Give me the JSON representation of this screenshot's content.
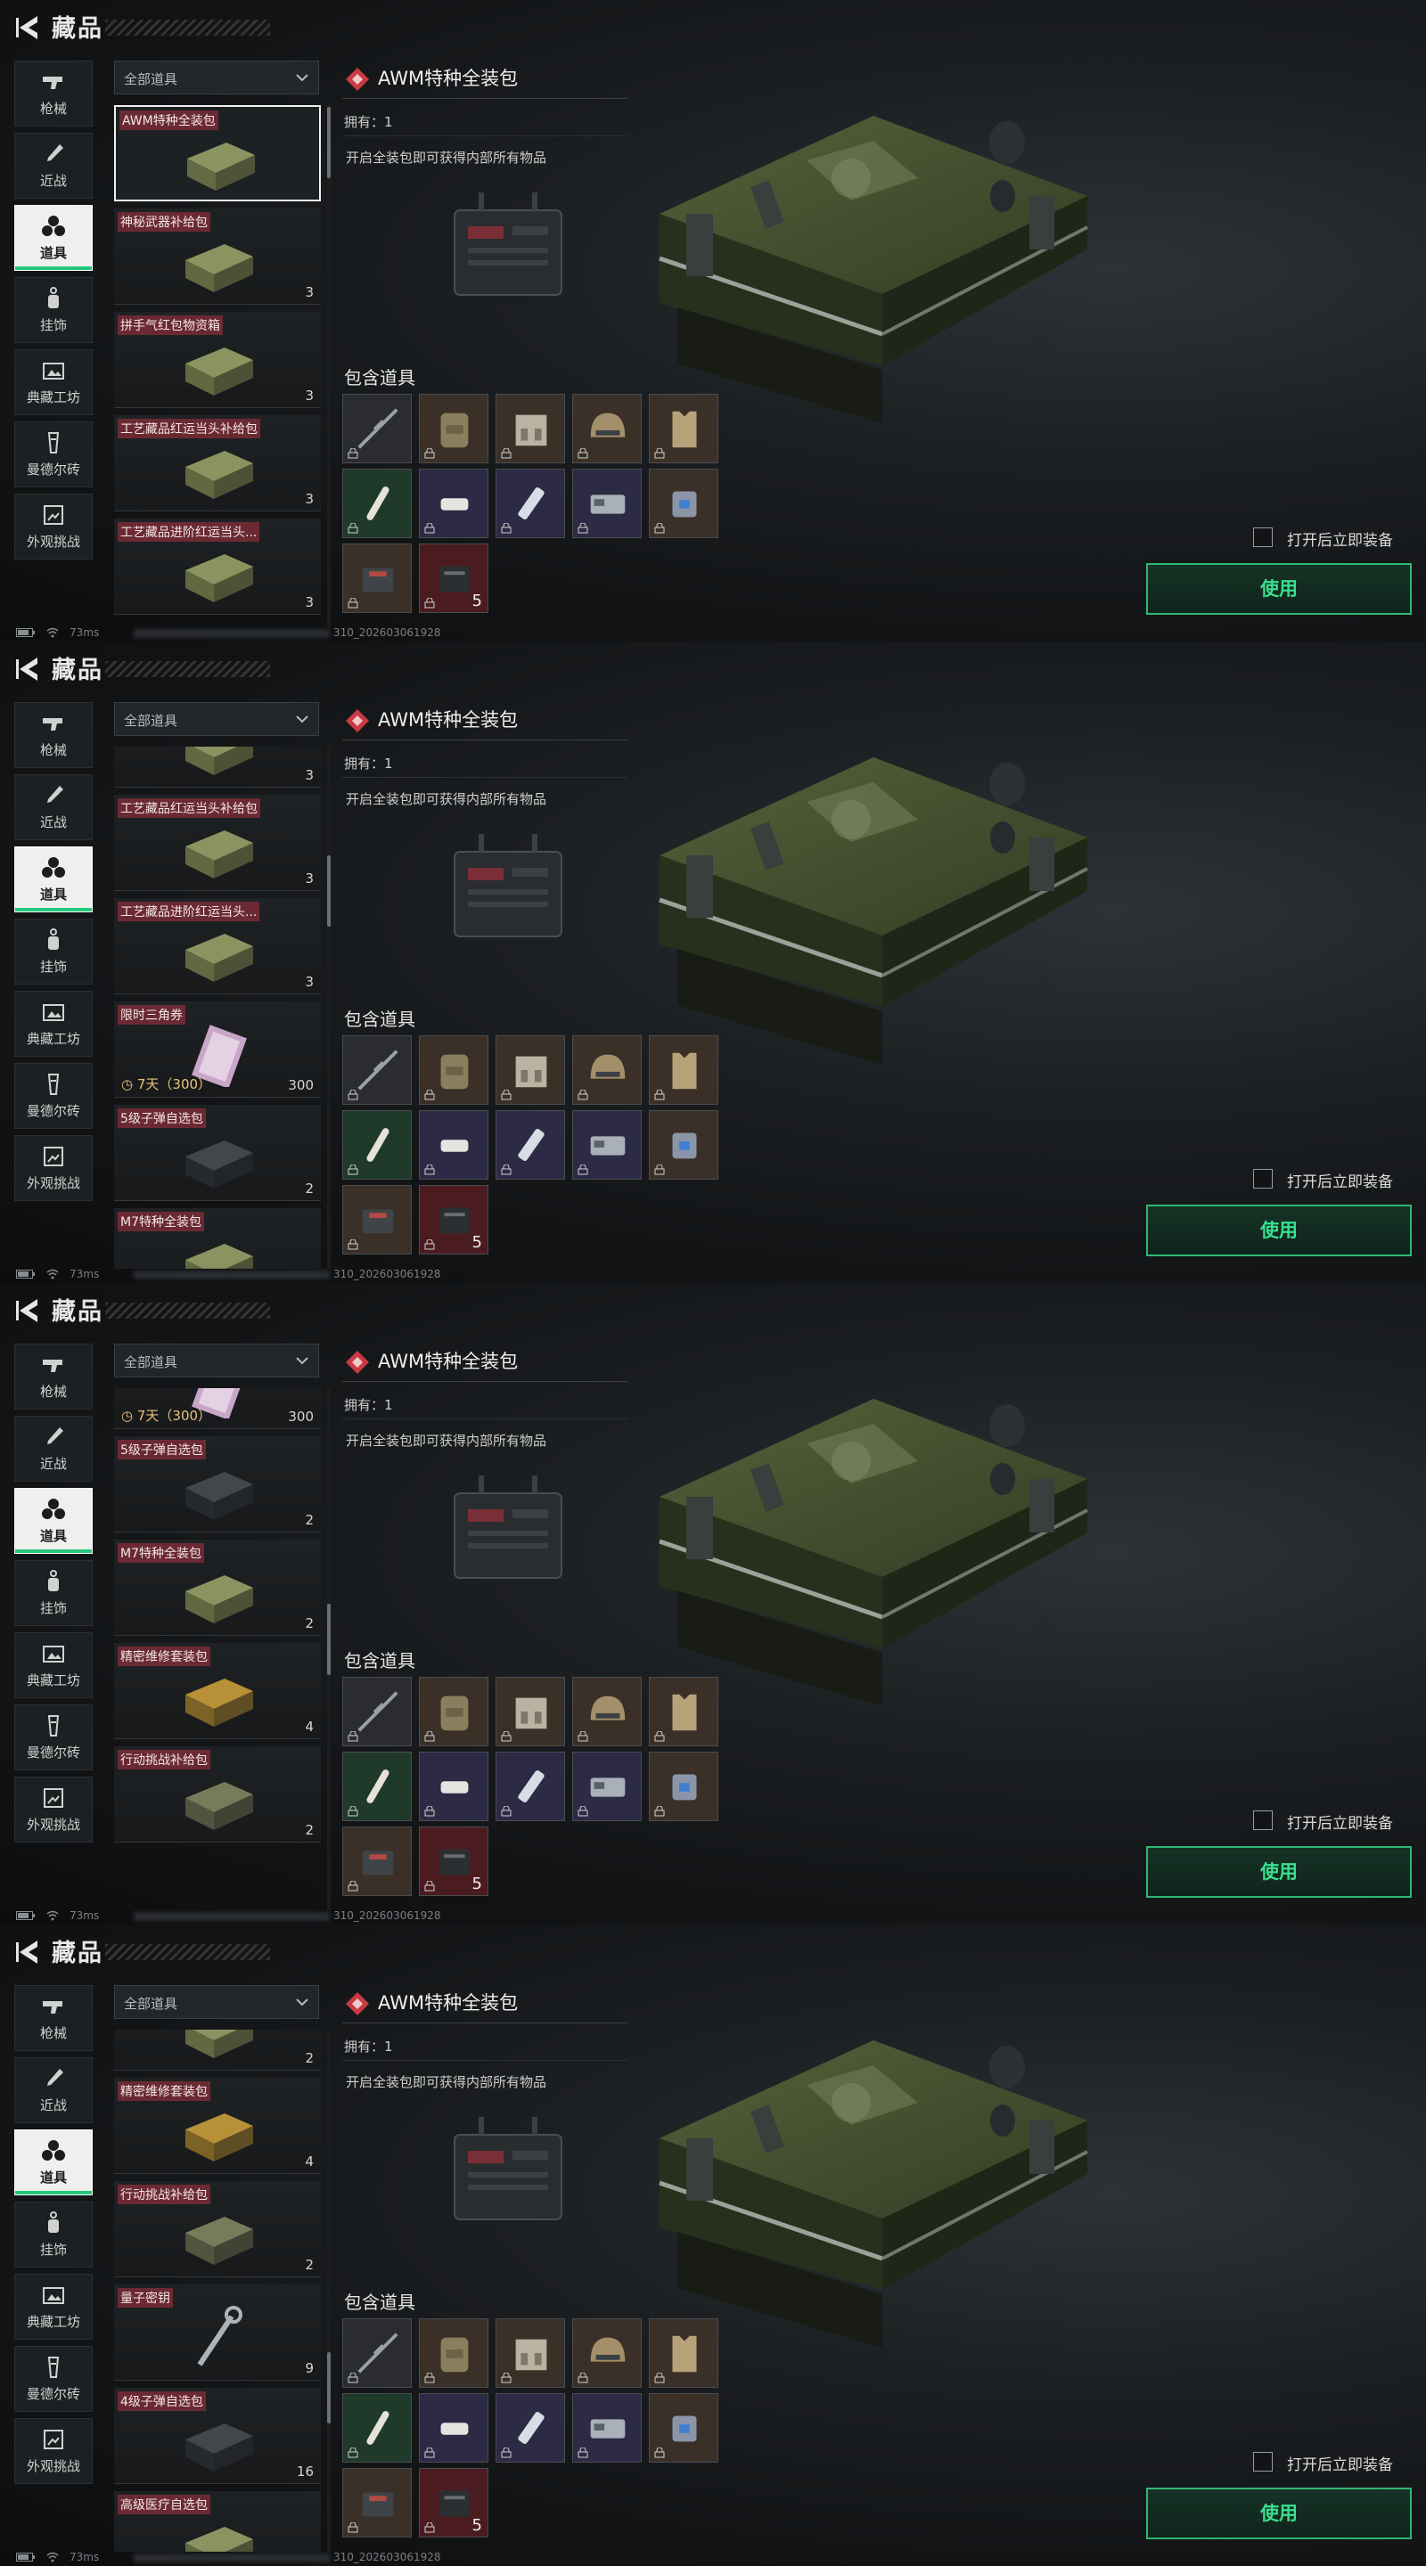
{
  "header": {
    "title": "藏品"
  },
  "sidebar": {
    "items": [
      {
        "label": "枪械",
        "icon": "gun-icon"
      },
      {
        "label": "近战",
        "icon": "knife-icon"
      },
      {
        "label": "道具",
        "icon": "items-icon",
        "active": true
      },
      {
        "label": "挂饰",
        "icon": "charm-icon"
      },
      {
        "label": "典藏工坊",
        "icon": "workshop-icon"
      },
      {
        "label": "曼德尔砖",
        "icon": "mandel-brick-icon"
      },
      {
        "label": "外观挑战",
        "icon": "appearance-challenge-icon"
      }
    ]
  },
  "filter": {
    "label": "全部道具"
  },
  "panels": [
    {
      "items": [
        {
          "name": "AWM特种全装包",
          "count": "",
          "selected": true
        },
        {
          "name": "神秘武器补给包",
          "count": "3"
        },
        {
          "name": "拼手气红包物资箱",
          "count": "3"
        },
        {
          "name": "工艺藏品红运当头补给包",
          "count": "3"
        },
        {
          "name": "工艺藏品进阶红运当头...",
          "count": "3"
        }
      ]
    },
    {
      "items": [
        {
          "name": "",
          "count": "3",
          "partial": true
        },
        {
          "name": "工艺藏品红运当头补给包",
          "count": "3"
        },
        {
          "name": "工艺藏品进阶红运当头...",
          "count": "3"
        },
        {
          "name": "限时三角券",
          "count": "300",
          "timer": "7天（300）"
        },
        {
          "name": "5级子弹自选包",
          "count": "2"
        },
        {
          "name": "M7特种全装包",
          "count": ""
        }
      ]
    },
    {
      "items": [
        {
          "name": "限时三角券",
          "count": "300",
          "timer": "7天（300）",
          "partial": true
        },
        {
          "name": "5级子弹自选包",
          "count": "2"
        },
        {
          "name": "M7特种全装包",
          "count": "2"
        },
        {
          "name": "精密维修套装包",
          "count": "4"
        },
        {
          "name": "行动挑战补给包",
          "count": "2"
        }
      ]
    },
    {
      "items": [
        {
          "name": "",
          "count": "2",
          "partial": true
        },
        {
          "name": "精密维修套装包",
          "count": "4"
        },
        {
          "name": "行动挑战补给包",
          "count": "2"
        },
        {
          "name": "量子密钥",
          "count": "9"
        },
        {
          "name": "4级子弹自选包",
          "count": "16"
        },
        {
          "name": "高级医疗自选包",
          "count": ""
        }
      ]
    }
  ],
  "detail": {
    "title": "AWM特种全装包",
    "owned": "拥有：1",
    "description": "开启全装包即可获得内部所有物品",
    "contains_label": "包含道具",
    "contents": [
      {
        "icon": "sniper-rifle-icon",
        "rarity": "gray"
      },
      {
        "icon": "backpack-icon",
        "rarity": "brown"
      },
      {
        "icon": "chest-rig-icon",
        "rarity": "brown"
      },
      {
        "icon": "helmet-icon",
        "rarity": "brown"
      },
      {
        "icon": "armor-vest-icon",
        "rarity": "brown"
      },
      {
        "icon": "injector-icon",
        "rarity": "green"
      },
      {
        "icon": "bandage-icon",
        "rarity": "purple"
      },
      {
        "icon": "medkit-spray-icon",
        "rarity": "purple"
      },
      {
        "icon": "keycard-icon",
        "rarity": "purple"
      },
      {
        "icon": "armor-repair-icon",
        "rarity": "brown"
      },
      {
        "icon": "repair-kit-icon",
        "rarity": "brown"
      },
      {
        "icon": "ammo-box-icon",
        "rarity": "red",
        "count": "5"
      }
    ],
    "auto_equip_label": "打开后立即装备",
    "use_label": "使用"
  },
  "status": {
    "ping": "73ms",
    "uid": "310_202603061928"
  },
  "colors": {
    "accent": "#2fb874",
    "active_tab": "#27c77b",
    "badge": "#6b2a33"
  }
}
